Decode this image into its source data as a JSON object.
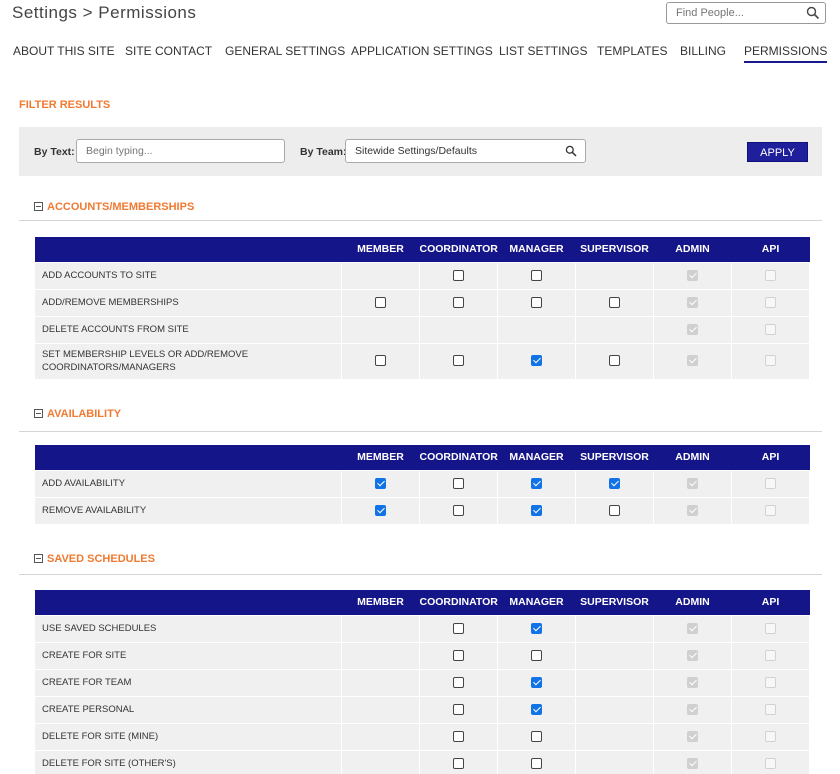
{
  "header": {
    "title": "Settings > Permissions",
    "search_placeholder": "Find People...",
    "search_icon": "search-icon"
  },
  "nav": [
    "ABOUT THIS SITE",
    "SITE CONTACT",
    "GENERAL SETTINGS",
    "APPLICATION SETTINGS",
    "LIST SETTINGS",
    "TEMPLATES",
    "BILLING",
    "PERMISSIONS"
  ],
  "nav_active": "PERMISSIONS",
  "filter": {
    "heading": "FILTER RESULTS",
    "by_text_label": "By Text:",
    "by_text_placeholder": "Begin typing...",
    "by_team_label": "By Team:",
    "by_team_value": "Sitewide Settings/Defaults",
    "apply_label": "APPLY"
  },
  "columns": [
    "MEMBER",
    "COORDINATOR",
    "MANAGER",
    "SUPERVISOR",
    "ADMIN",
    "API"
  ],
  "sections": [
    {
      "title": "ACCOUNTS/MEMBERSHIPS",
      "rows": [
        {
          "label": "ADD ACCOUNTS TO SITE",
          "cells": [
            "none",
            "off",
            "off",
            "none",
            "dis-on",
            "dis"
          ]
        },
        {
          "label": "ADD/REMOVE MEMBERSHIPS",
          "cells": [
            "off",
            "off",
            "off",
            "off",
            "dis-on",
            "dis"
          ]
        },
        {
          "label": "DELETE ACCOUNTS FROM SITE",
          "cells": [
            "none",
            "none",
            "none",
            "none",
            "dis-on",
            "dis"
          ]
        },
        {
          "label": "SET MEMBERSHIP LEVELS OR ADD/REMOVE COORDINATORS/MANAGERS",
          "cells": [
            "off",
            "off",
            "on",
            "off",
            "dis-on",
            "dis"
          ]
        }
      ]
    },
    {
      "title": "AVAILABILITY",
      "rows": [
        {
          "label": "ADD AVAILABILITY",
          "cells": [
            "on",
            "off",
            "on",
            "on",
            "dis-on",
            "dis"
          ]
        },
        {
          "label": "REMOVE AVAILABILITY",
          "cells": [
            "on",
            "off",
            "on",
            "off",
            "dis-on",
            "dis"
          ]
        }
      ]
    },
    {
      "title": "SAVED SCHEDULES",
      "rows": [
        {
          "label": "USE SAVED SCHEDULES",
          "cells": [
            "none",
            "off",
            "on",
            "none",
            "dis-on",
            "dis"
          ]
        },
        {
          "label": "CREATE FOR SITE",
          "cells": [
            "none",
            "off",
            "off",
            "none",
            "dis-on",
            "dis"
          ]
        },
        {
          "label": "CREATE FOR TEAM",
          "cells": [
            "none",
            "off",
            "on",
            "none",
            "dis-on",
            "dis"
          ]
        },
        {
          "label": "CREATE PERSONAL",
          "cells": [
            "none",
            "off",
            "on",
            "none",
            "dis-on",
            "dis"
          ]
        },
        {
          "label": "DELETE FOR SITE (MINE)",
          "cells": [
            "none",
            "off",
            "off",
            "none",
            "dis-on",
            "dis"
          ]
        },
        {
          "label": "DELETE FOR SITE (OTHER'S)",
          "cells": [
            "none",
            "off",
            "off",
            "none",
            "dis-on",
            "dis"
          ]
        }
      ]
    }
  ]
}
